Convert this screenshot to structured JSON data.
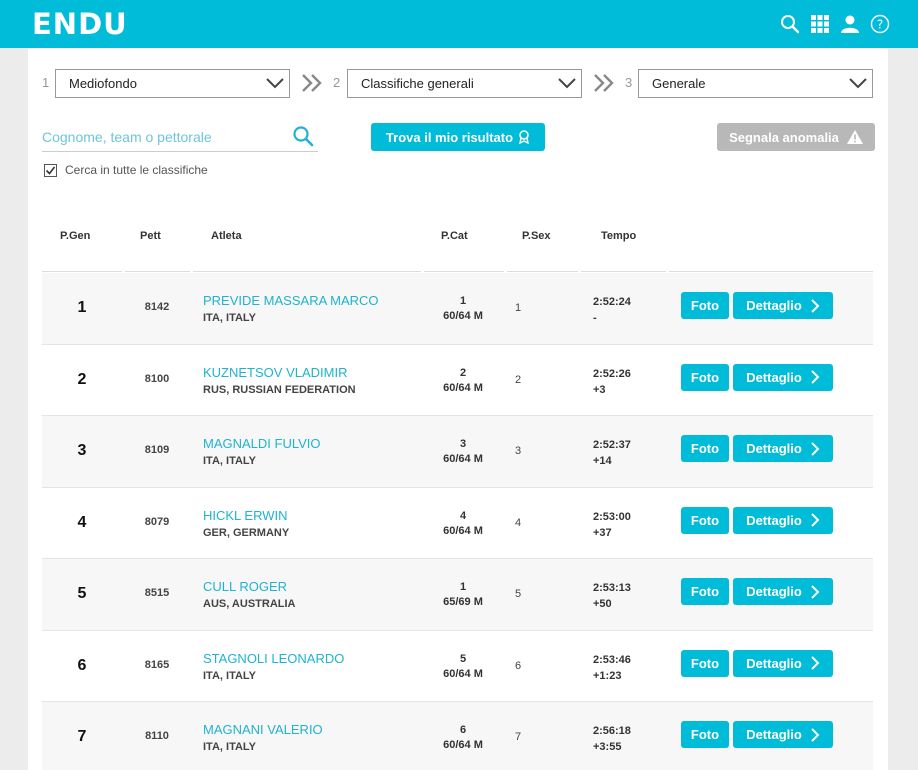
{
  "header": {
    "logo": "ENDU",
    "icons": [
      "search-icon",
      "grid-icon",
      "user-icon",
      "help-icon"
    ]
  },
  "filters": [
    {
      "step": "1",
      "value": "Mediofondo"
    },
    {
      "step": "2",
      "value": "Classifiche generali"
    },
    {
      "step": "3",
      "value": "Generale"
    }
  ],
  "search": {
    "placeholder": "Cognome, team o pettorale"
  },
  "actions": {
    "find_result": "Trova il mio risultato",
    "report_anomaly": "Segnala anomalia"
  },
  "search_all": {
    "label": "Cerca in tutte le classifiche",
    "checked": true
  },
  "table": {
    "headers": {
      "pgen": "P.Gen",
      "pett": "Pett",
      "atleta": "Atleta",
      "pcat": "P.Cat",
      "psex": "P.Sex",
      "tempo": "Tempo"
    },
    "foto_label": "Foto",
    "detail_label": "Dettaglio",
    "rows": [
      {
        "pgen": "1",
        "pett": "8142",
        "name": "PREVIDE MASSARA MARCO",
        "nat": "ITA, ITALY",
        "pcat": "1",
        "cat": "60/64 M",
        "psex": "1",
        "time": "2:52:24",
        "gap": "-"
      },
      {
        "pgen": "2",
        "pett": "8100",
        "name": "KUZNETSOV VLADIMIR",
        "nat": "RUS, RUSSIAN FEDERATION",
        "pcat": "2",
        "cat": "60/64 M",
        "psex": "2",
        "time": "2:52:26",
        "gap": "+3"
      },
      {
        "pgen": "3",
        "pett": "8109",
        "name": "MAGNALDI FULVIO",
        "nat": "ITA, ITALY",
        "pcat": "3",
        "cat": "60/64 M",
        "psex": "3",
        "time": "2:52:37",
        "gap": "+14"
      },
      {
        "pgen": "4",
        "pett": "8079",
        "name": "HICKL ERWIN",
        "nat": "GER, GERMANY",
        "pcat": "4",
        "cat": "60/64 M",
        "psex": "4",
        "time": "2:53:00",
        "gap": "+37"
      },
      {
        "pgen": "5",
        "pett": "8515",
        "name": "CULL ROGER",
        "nat": "AUS, AUSTRALIA",
        "pcat": "1",
        "cat": "65/69 M",
        "psex": "5",
        "time": "2:53:13",
        "gap": "+50"
      },
      {
        "pgen": "6",
        "pett": "8165",
        "name": "STAGNOLI LEONARDO",
        "nat": "ITA, ITALY",
        "pcat": "5",
        "cat": "60/64 M",
        "psex": "6",
        "time": "2:53:46",
        "gap": "+1:23"
      },
      {
        "pgen": "7",
        "pett": "8110",
        "name": "MAGNANI VALERIO",
        "nat": "ITA, ITALY",
        "pcat": "6",
        "cat": "60/64 M",
        "psex": "7",
        "time": "2:56:18",
        "gap": "+3:55"
      }
    ]
  },
  "colors": {
    "accent": "#00bcd8",
    "link": "#1fb3cf",
    "disabled": "#b8b8b8"
  }
}
